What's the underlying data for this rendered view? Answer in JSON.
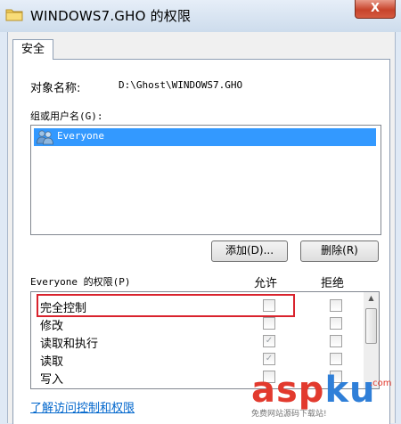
{
  "window": {
    "title": "WINDOWS7.GHO 的权限",
    "close_label": "X"
  },
  "tabs": [
    {
      "label": "安全"
    }
  ],
  "object": {
    "label": "对象名称:",
    "value": "D:\\Ghost\\WINDOWS7.GHO"
  },
  "groups": {
    "label": "组或用户名(G):",
    "items": [
      {
        "name": "Everyone",
        "selected": true
      }
    ]
  },
  "buttons": {
    "add": "添加(D)...",
    "remove": "删除(R)"
  },
  "permissions": {
    "label": "Everyone 的权限(P)",
    "allow_header": "允许",
    "deny_header": "拒绝",
    "rows": [
      {
        "name": "完全控制",
        "allow": false,
        "deny": false
      },
      {
        "name": "修改",
        "allow": false,
        "deny": false
      },
      {
        "name": "读取和执行",
        "allow": true,
        "deny": false
      },
      {
        "name": "读取",
        "allow": true,
        "deny": false
      },
      {
        "name": "写入",
        "allow": false,
        "deny": false
      }
    ]
  },
  "link": "了解访问控制和权限",
  "watermark": {
    "logo_a": "asp",
    "logo_b": "ku",
    "suffix": ".com",
    "tagline": "免费网站源码下载站!"
  },
  "colors": {
    "selection": "#3399ff",
    "highlight_box": "#d9232d",
    "link": "#0066cc"
  }
}
